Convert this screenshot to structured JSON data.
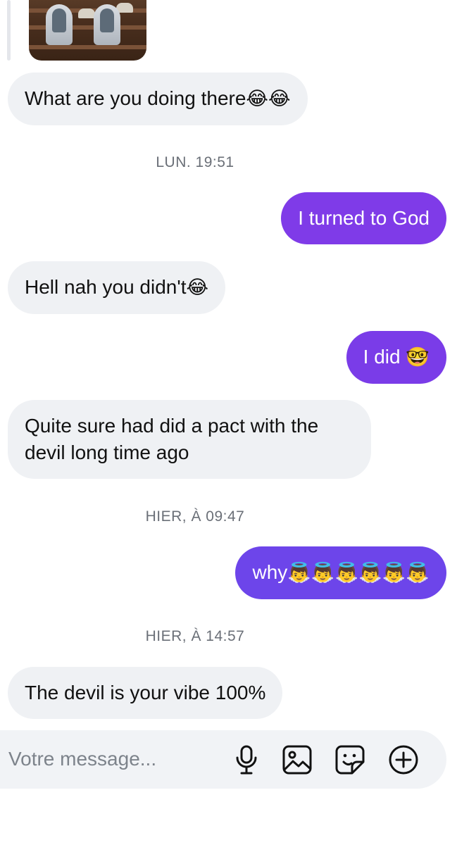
{
  "conversation": {
    "timestamps": {
      "mon": "LUN. 19:51",
      "yesterday_morning": "HIER, À 09:47",
      "yesterday_afternoon": "HIER, À 14:57"
    },
    "messages": {
      "m1": {
        "text": "What are you doing there",
        "emoji": "😂😂"
      },
      "m2": {
        "text": "I turned to God"
      },
      "m3": {
        "text": "Hell nah you didn't",
        "emoji": "😂"
      },
      "m4": {
        "text": "I did ",
        "emoji": "🤓"
      },
      "m5": {
        "line1": "Quite sure had did a pact with the",
        "line2": "devil long time ago"
      },
      "m6": {
        "text": "why",
        "emoji": "👼👼👼👼👼👼"
      },
      "m7": {
        "text": "The devil is your vibe 100%"
      }
    }
  },
  "composer": {
    "placeholder": "Votre message...",
    "icons": [
      "microphone-icon",
      "image-icon",
      "sticker-icon",
      "plus-circle-icon"
    ]
  },
  "colors": {
    "incoming_bubble": "#eff1f4",
    "outgoing_bubble_1": "#7f3be8",
    "outgoing_bubble_2": "#7a3ce8",
    "outgoing_bubble_3": "#6d45ea",
    "outgoing_bubble_4": "#6848ec",
    "timestamp_text": "#6a6f77"
  }
}
